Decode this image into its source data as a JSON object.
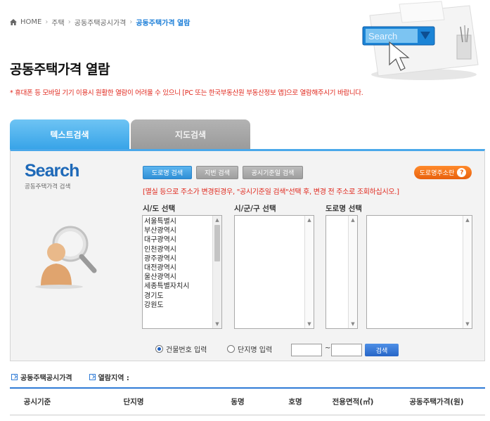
{
  "breadcrumb": {
    "home": "HOME",
    "items": [
      "주택",
      "공동주택공시가격"
    ],
    "current": "공동주택가격 열람"
  },
  "hero": {
    "search_label": "Search"
  },
  "page_title": "공동주택가격 열람",
  "notice": "* 휴대폰 등 모바일 기기 이용시 원활한 열람이 어려울 수 있으니 [PC 또는 한국부동산원 부동산정보 앱]으로 열람해주시기 바랍니다.",
  "tabs": [
    {
      "label": "텍스트검색",
      "active": true
    },
    {
      "label": "지도검색",
      "active": false
    }
  ],
  "search_panel": {
    "logo_word": "Search",
    "logo_sub": "공동주택가격 검색",
    "mode_buttons": [
      {
        "label": "도로명 검색",
        "active": true
      },
      {
        "label": "지번 검색",
        "active": false
      },
      {
        "label": "공시기준일 검색",
        "active": false
      }
    ],
    "guide_button": "도로명주소란",
    "red_note": "[멸실 등으로 주소가 변경된경우, \"공시기준일 검색\"선택 후, 변경 전 주소로 조회하십시오.]",
    "labels": {
      "sido": "시/도 선택",
      "sigungu": "시/군/구 선택",
      "road": "도로명 선택"
    },
    "sido_options": [
      "서울특별시",
      "부산광역시",
      "대구광역시",
      "인천광역시",
      "광주광역시",
      "대전광역시",
      "울산광역시",
      "세종특별자치시",
      "경기도",
      "강원도"
    ],
    "radios": [
      {
        "label": "건물번호 입력",
        "checked": true
      },
      {
        "label": "단지명 입력",
        "checked": false
      }
    ],
    "range_separator": "~",
    "search_button": "검색"
  },
  "info": {
    "price_label": "공동주택공시가격",
    "region_label": "열람지역 :"
  },
  "table": {
    "headers": [
      "공시기준",
      "단지명",
      "동명",
      "호명",
      "전용면적(㎡)",
      "공동주택가격(원)"
    ]
  },
  "colors": {
    "accent_blue": "#2f7bd6",
    "alert_red": "#e0261b",
    "orange": "#e8600d"
  }
}
